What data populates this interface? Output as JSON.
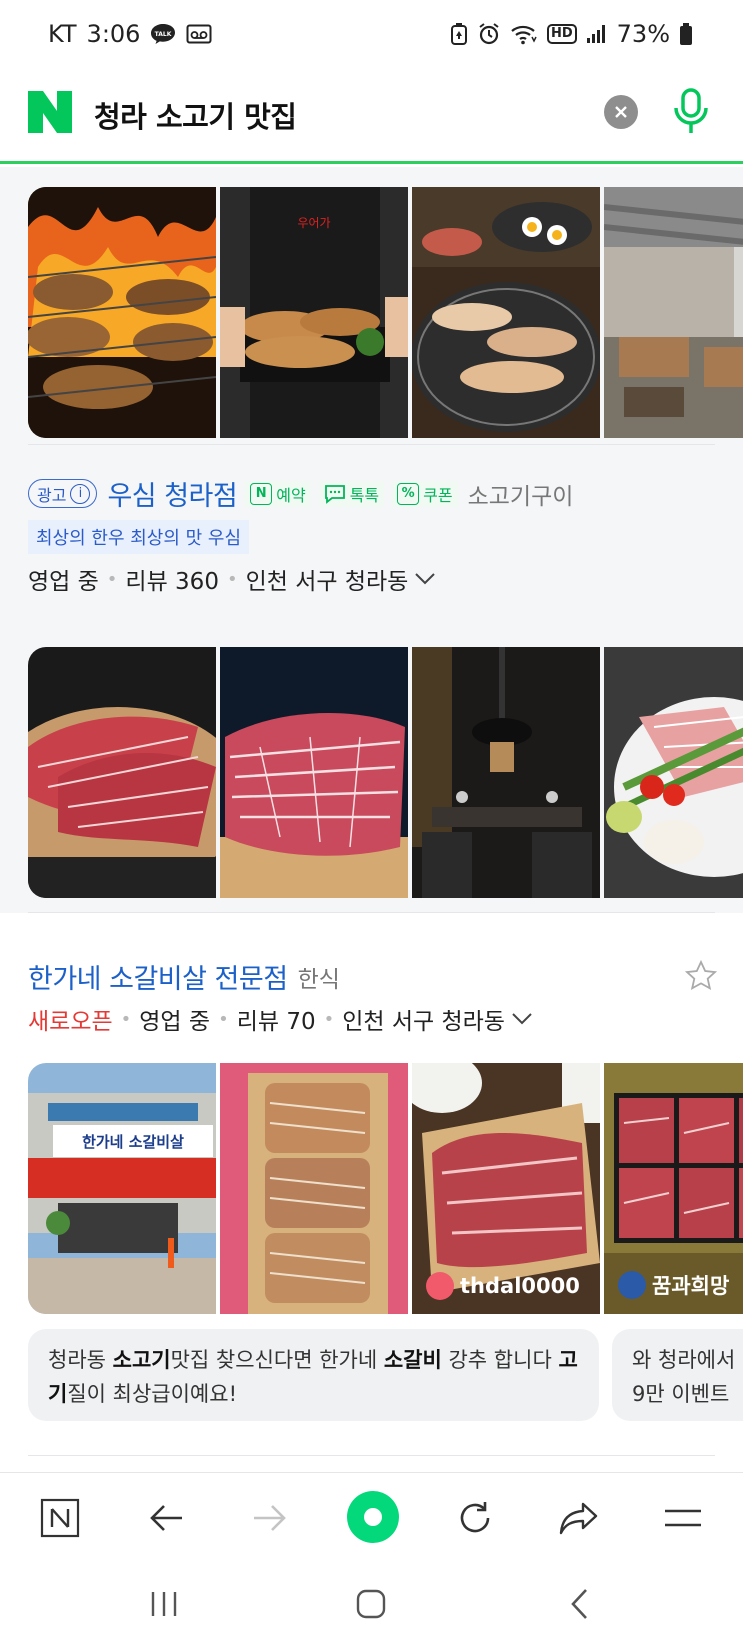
{
  "status_bar": {
    "carrier": "KT",
    "time": "3:06",
    "battery": "73%",
    "hd": "HD"
  },
  "search": {
    "logo": "N",
    "query": "청라 소고기 맛집"
  },
  "result1": {
    "ad_label": "광고",
    "name": "우심 청라점",
    "tags": [
      "예약",
      "톡톡",
      "쿠폰"
    ],
    "category": "소고기구이",
    "slogan": "최상의 한우 최상의 맛 우심",
    "status": "영업 중",
    "reviews": "리뷰 360",
    "location": "인천 서구 청라동"
  },
  "result2": {
    "name": "한가네 소갈비살 전문점",
    "category": "한식",
    "new_label": "새로오픈",
    "status": "영업 중",
    "reviews": "리뷰 70",
    "location": "인천 서구 청라동",
    "photo_users": [
      "thdal0000",
      "꿈과희망"
    ],
    "review_1": {
      "p1": "청라동 ",
      "b1": "소고기",
      "p2": "맛집 찾으신다면 한가네 ",
      "b2": "소갈비",
      "p3": " 강추 합니다 ",
      "b3": "고기",
      "p4": "질이 최상급이예요!"
    },
    "review_2": {
      "line1": "와 청라에서",
      "line2": "9만 이벤트"
    }
  },
  "colors": {
    "brand_green": "#03c75a",
    "link_blue": "#1b61c9",
    "new_red": "#e53935"
  },
  "icons": {
    "toolbar": [
      "naver-home-icon",
      "back-arrow-icon",
      "forward-arrow-icon",
      "green-dot-icon",
      "refresh-icon",
      "share-icon",
      "menu-icon"
    ],
    "system_nav": [
      "recent-apps-icon",
      "home-icon",
      "back-icon"
    ]
  }
}
